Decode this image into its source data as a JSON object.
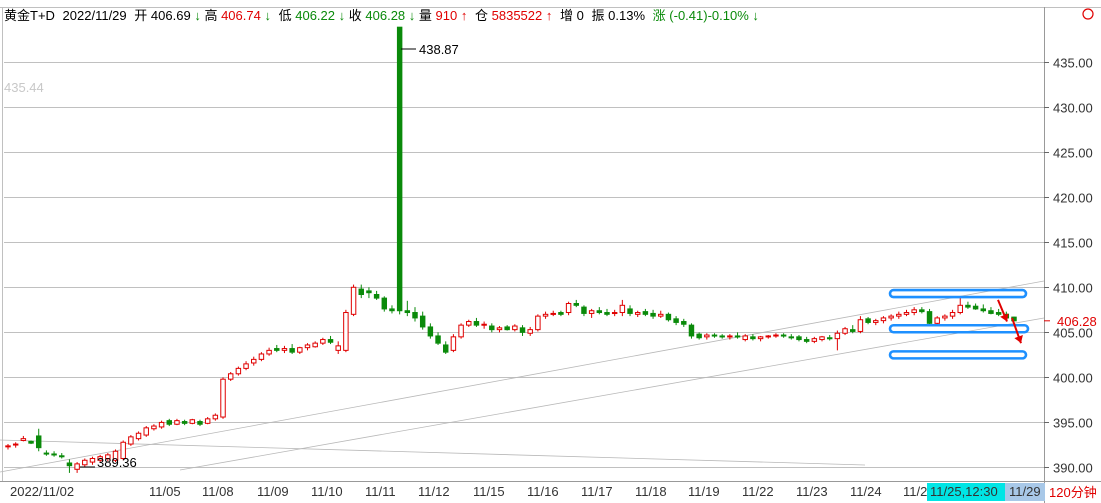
{
  "header": {
    "instrument": "黄金T+D",
    "date": "2022/11/29",
    "open_label": "开",
    "open": "406.69",
    "open_arrow": "↓",
    "high_label": "高",
    "high": "406.74",
    "high_arrow": "↓",
    "low_label": "低",
    "low": "406.22",
    "low_arrow": "↓",
    "close_label": "收",
    "close": "406.28",
    "close_arrow": "↓",
    "volume_label": "量",
    "volume": "910",
    "volume_arrow": "↑",
    "position_label": "仓",
    "position": "5835522",
    "position_arrow": "↑",
    "increase_label": "增",
    "increase": "0",
    "amplitude_label": "振",
    "amplitude": "0.13%",
    "change_label": "涨",
    "change": "(-0.41)-0.10%",
    "change_arrow": "↓"
  },
  "colors": {
    "up": "#e00000",
    "down": "#0a8a0a",
    "grid": "#c0c0c0",
    "highlight": "#1e90ff",
    "annotation_arrow": "#e00000",
    "date_badge_bg": "#00e5e5",
    "last_date_badge_bg": "#a8c8e8",
    "price_tag": "#e00000"
  },
  "icons": {
    "top_right": "circle-icon"
  },
  "chart_data": {
    "type": "candlestick",
    "period_label": "120分钟",
    "y_axis": {
      "min": 388.5,
      "max": 441,
      "ticks": [
        390,
        395,
        400,
        405,
        410,
        415,
        420,
        425,
        430,
        435
      ]
    },
    "y_tick_labels": [
      "390.00",
      "395.00",
      "400.00",
      "405.00",
      "410.00",
      "415.00",
      "420.00",
      "425.00",
      "430.00",
      "435.00"
    ],
    "x_labels": [
      "2022/11/02",
      "11/05",
      "11/08",
      "11/09",
      "11/10",
      "11/11",
      "11/12",
      "11/15",
      "11/16",
      "11/17",
      "11/18",
      "11/19",
      "11/22",
      "11/23",
      "11/24",
      "11/2",
      "11/25,12:30",
      "11/29"
    ],
    "annotations": {
      "max_label": "438.87",
      "min_label": "389.36",
      "ref_label": "435.44",
      "last_price_label": "406.28"
    },
    "candles": [
      [
        392.3,
        392.6,
        392.0,
        392.4
      ],
      [
        392.5,
        392.8,
        392.2,
        392.6
      ],
      [
        393.0,
        393.5,
        392.9,
        393.2
      ],
      [
        392.9,
        393.0,
        392.6,
        392.7
      ],
      [
        393.5,
        394.3,
        391.8,
        392.2
      ],
      [
        391.6,
        391.9,
        391.3,
        391.5
      ],
      [
        391.5,
        391.8,
        391.2,
        391.4
      ],
      [
        391.3,
        391.6,
        391.0,
        391.2
      ],
      [
        390.5,
        390.9,
        389.4,
        390.2
      ],
      [
        389.8,
        390.6,
        389.4,
        390.4
      ],
      [
        390.3,
        391.0,
        390.1,
        390.8
      ],
      [
        390.6,
        391.2,
        390.3,
        391.0
      ],
      [
        390.8,
        391.4,
        390.5,
        391.2
      ],
      [
        391.0,
        391.6,
        390.7,
        391.4
      ],
      [
        390.8,
        392.0,
        390.6,
        391.8
      ],
      [
        391.0,
        393.0,
        390.8,
        392.8
      ],
      [
        392.6,
        393.6,
        392.4,
        393.4
      ],
      [
        393.2,
        394.0,
        393.0,
        393.8
      ],
      [
        393.6,
        394.6,
        393.4,
        394.4
      ],
      [
        394.3,
        394.8,
        394.1,
        394.6
      ],
      [
        394.5,
        395.2,
        394.3,
        395.0
      ],
      [
        395.2,
        395.4,
        394.6,
        394.8
      ],
      [
        394.8,
        395.4,
        394.7,
        395.2
      ],
      [
        395.1,
        395.3,
        394.7,
        394.9
      ],
      [
        394.9,
        395.4,
        394.8,
        395.3
      ],
      [
        395.1,
        395.3,
        394.6,
        394.8
      ],
      [
        394.9,
        395.6,
        394.8,
        395.4
      ],
      [
        395.4,
        396.0,
        395.2,
        395.8
      ],
      [
        395.6,
        400.0,
        395.4,
        399.8
      ],
      [
        399.8,
        400.6,
        399.6,
        400.4
      ],
      [
        400.4,
        401.2,
        400.2,
        401.0
      ],
      [
        401.0,
        401.8,
        400.8,
        401.5
      ],
      [
        401.6,
        402.3,
        401.3,
        402.0
      ],
      [
        402.0,
        402.8,
        401.8,
        402.6
      ],
      [
        402.6,
        403.3,
        402.4,
        403.0
      ],
      [
        403.2,
        403.6,
        402.8,
        403.0
      ],
      [
        403.0,
        403.5,
        402.7,
        403.2
      ],
      [
        403.2,
        403.7,
        402.6,
        402.8
      ],
      [
        402.8,
        403.4,
        402.6,
        403.3
      ],
      [
        403.3,
        403.8,
        403.0,
        403.6
      ],
      [
        403.4,
        404.0,
        403.3,
        403.8
      ],
      [
        403.8,
        404.4,
        403.6,
        404.2
      ],
      [
        404.2,
        404.6,
        403.7,
        403.9
      ],
      [
        403.0,
        404.0,
        402.6,
        403.5
      ],
      [
        403.0,
        407.5,
        402.8,
        407.2
      ],
      [
        407.0,
        410.3,
        406.8,
        410.0
      ],
      [
        409.8,
        410.3,
        408.8,
        409.2
      ],
      [
        409.6,
        410.0,
        408.8,
        409.4
      ],
      [
        409.2,
        409.6,
        408.6,
        408.8
      ],
      [
        408.8,
        409.0,
        407.3,
        407.6
      ],
      [
        407.6,
        408.0,
        407.1,
        407.4
      ],
      [
        438.87,
        438.87,
        407.0,
        407.4
      ],
      [
        407.4,
        408.5,
        406.8,
        407.2
      ],
      [
        407.2,
        407.8,
        406.2,
        406.6
      ],
      [
        406.8,
        407.3,
        405.3,
        405.6
      ],
      [
        405.6,
        406.0,
        404.3,
        404.6
      ],
      [
        404.6,
        405.0,
        403.6,
        403.8
      ],
      [
        403.6,
        404.0,
        402.6,
        402.8
      ],
      [
        403.0,
        404.8,
        402.8,
        404.5
      ],
      [
        404.5,
        406.0,
        404.3,
        405.8
      ],
      [
        405.8,
        406.4,
        405.6,
        406.2
      ],
      [
        406.2,
        406.6,
        405.6,
        405.8
      ],
      [
        405.8,
        406.2,
        405.4,
        405.9
      ],
      [
        405.7,
        406.0,
        405.0,
        405.3
      ],
      [
        405.3,
        405.7,
        405.0,
        405.5
      ],
      [
        405.6,
        405.8,
        405.2,
        405.3
      ],
      [
        405.3,
        405.9,
        405.1,
        405.7
      ],
      [
        405.5,
        405.8,
        404.6,
        405.0
      ],
      [
        404.9,
        405.6,
        404.6,
        405.3
      ],
      [
        405.3,
        407.0,
        405.1,
        406.8
      ],
      [
        406.8,
        407.3,
        406.5,
        407.0
      ],
      [
        407.0,
        407.4,
        406.8,
        407.1
      ],
      [
        407.2,
        407.4,
        406.8,
        407.0
      ],
      [
        407.2,
        408.4,
        406.9,
        408.2
      ],
      [
        408.2,
        408.6,
        407.8,
        408.0
      ],
      [
        407.8,
        408.0,
        406.8,
        407.1
      ],
      [
        407.1,
        407.6,
        406.6,
        407.4
      ],
      [
        407.4,
        407.8,
        407.0,
        407.2
      ],
      [
        407.2,
        407.6,
        406.8,
        407.0
      ],
      [
        407.1,
        407.5,
        406.8,
        407.2
      ],
      [
        407.2,
        408.6,
        406.8,
        408.0
      ],
      [
        407.6,
        408.0,
        406.8,
        407.1
      ],
      [
        407.0,
        407.4,
        406.7,
        407.2
      ],
      [
        407.3,
        407.6,
        406.8,
        407.0
      ],
      [
        407.1,
        407.5,
        406.5,
        406.8
      ],
      [
        406.8,
        407.4,
        406.6,
        407.0
      ],
      [
        407.0,
        407.2,
        406.2,
        406.4
      ],
      [
        406.5,
        406.8,
        405.8,
        406.1
      ],
      [
        406.2,
        406.5,
        405.6,
        405.9
      ],
      [
        405.8,
        406.0,
        404.3,
        404.6
      ],
      [
        404.8,
        405.0,
        404.2,
        404.4
      ],
      [
        404.5,
        404.9,
        404.2,
        404.7
      ],
      [
        404.7,
        404.9,
        404.4,
        404.6
      ],
      [
        404.6,
        404.8,
        404.3,
        404.5
      ],
      [
        404.5,
        404.8,
        404.2,
        404.6
      ],
      [
        404.6,
        405.0,
        404.3,
        404.5
      ],
      [
        404.2,
        404.8,
        404.0,
        404.6
      ],
      [
        404.5,
        404.8,
        404.1,
        404.3
      ],
      [
        404.3,
        404.6,
        404.0,
        404.5
      ],
      [
        404.5,
        404.7,
        404.3,
        404.6
      ],
      [
        404.6,
        404.9,
        404.4,
        404.7
      ],
      [
        404.7,
        404.9,
        404.4,
        404.6
      ],
      [
        404.5,
        404.8,
        404.2,
        404.4
      ],
      [
        404.5,
        404.7,
        404.0,
        404.2
      ],
      [
        404.2,
        404.5,
        403.8,
        404.0
      ],
      [
        404.0,
        404.5,
        403.8,
        404.3
      ],
      [
        404.2,
        404.6,
        404.0,
        404.5
      ],
      [
        404.4,
        404.7,
        404.1,
        404.3
      ],
      [
        404.3,
        405.2,
        403.0,
        404.9
      ],
      [
        404.9,
        405.6,
        404.7,
        405.4
      ],
      [
        405.3,
        405.8,
        404.9,
        405.1
      ],
      [
        405.1,
        406.8,
        404.9,
        406.4
      ],
      [
        406.5,
        406.7,
        405.9,
        406.1
      ],
      [
        406.1,
        406.5,
        405.8,
        406.3
      ],
      [
        406.3,
        406.8,
        406.0,
        406.6
      ],
      [
        406.6,
        407.0,
        406.3,
        406.8
      ],
      [
        406.8,
        407.3,
        406.5,
        407.0
      ],
      [
        407.0,
        407.5,
        406.8,
        407.2
      ],
      [
        407.2,
        407.8,
        406.9,
        407.5
      ],
      [
        407.5,
        407.8,
        407.1,
        407.3
      ],
      [
        407.3,
        407.6,
        405.8,
        406.0
      ],
      [
        406.0,
        406.8,
        405.8,
        406.6
      ],
      [
        406.6,
        407.0,
        406.3,
        406.8
      ],
      [
        406.8,
        407.5,
        406.5,
        407.2
      ],
      [
        407.2,
        408.9,
        407.0,
        408.0
      ],
      [
        408.0,
        408.4,
        407.6,
        407.8
      ],
      [
        407.9,
        408.2,
        407.5,
        407.6
      ],
      [
        407.6,
        408.1,
        407.2,
        407.4
      ],
      [
        407.4,
        407.8,
        407.0,
        407.1
      ],
      [
        407.2,
        407.6,
        406.8,
        407.0
      ],
      [
        407.0,
        407.3,
        406.5,
        406.6
      ],
      [
        406.69,
        406.74,
        406.22,
        406.28
      ]
    ]
  }
}
